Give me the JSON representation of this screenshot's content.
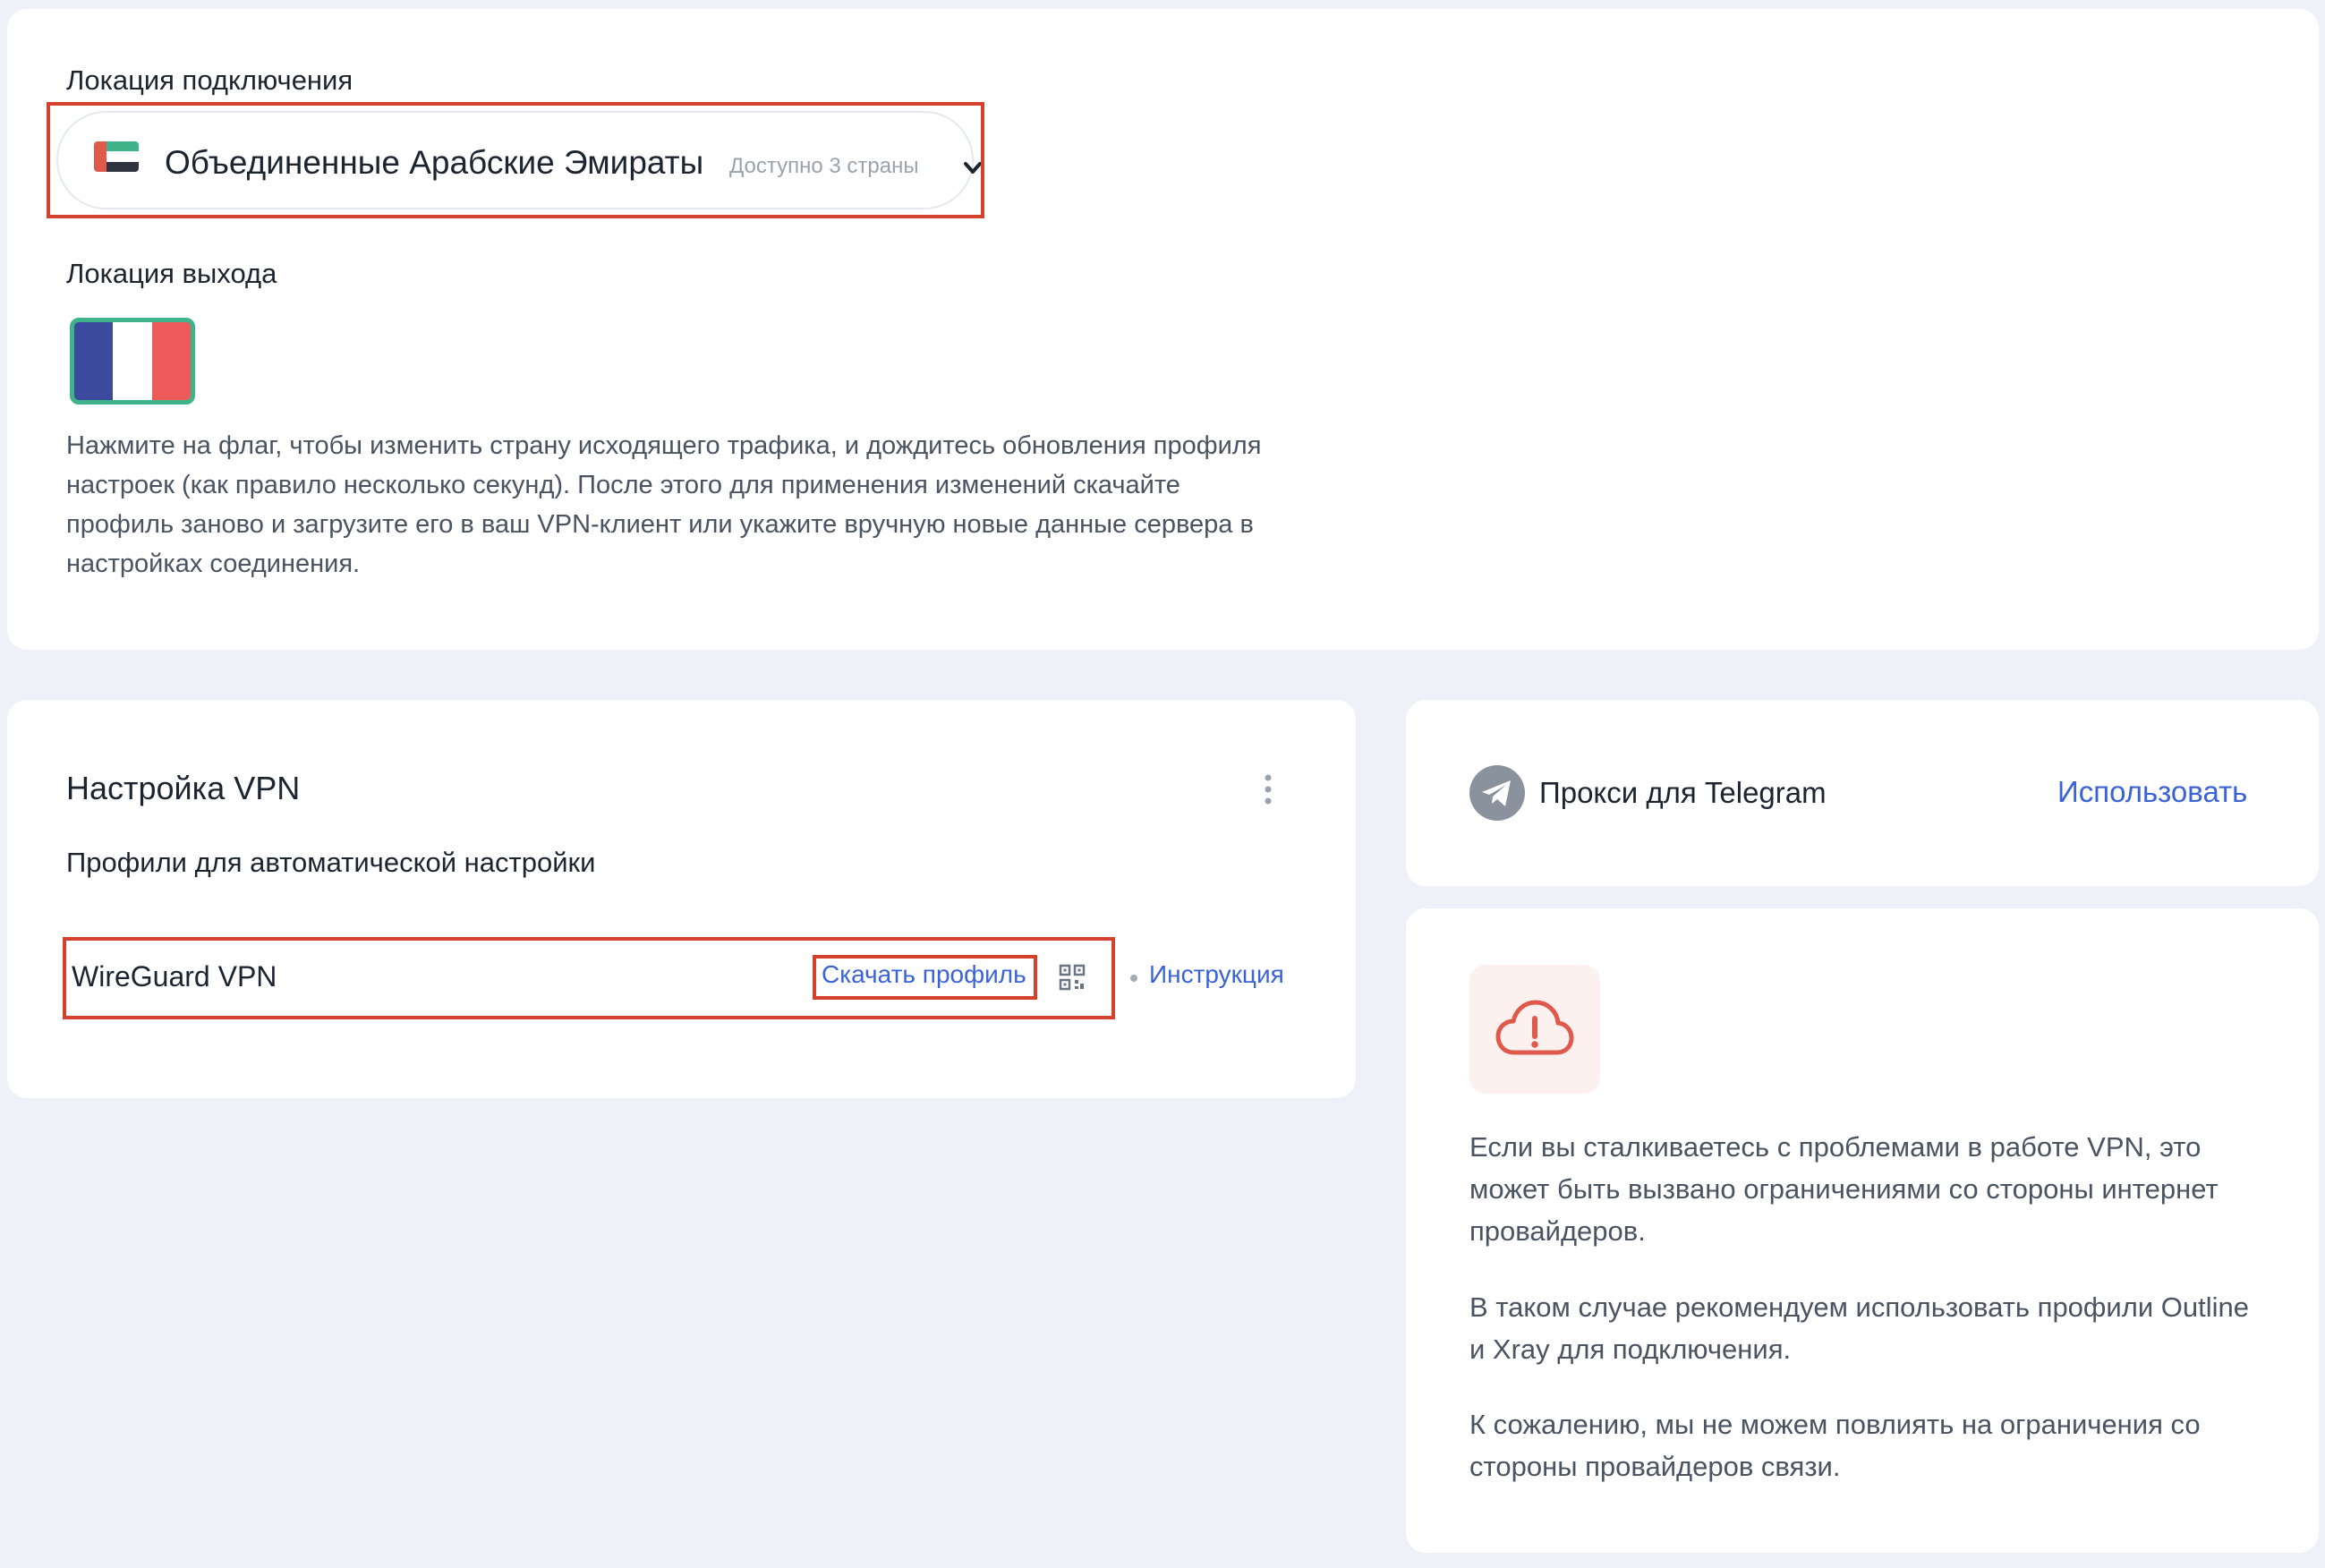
{
  "location": {
    "connection_label": "Локация подключения",
    "selected_country": "Объединенные Арабские Эмираты",
    "available_text": "Доступно 3 страны",
    "exit_label": "Локация выхода",
    "exit_description": "Нажмите на флаг, чтобы изменить страну исходящего трафика, и дождитесь обновления профиля настроек (как правило несколько секунд). После этого для применения изменений скачайте профиль заново и загрузите его в ваш VPN-клиент или укажите вручную новые данные сервера в настройках соединения.",
    "connection_flag_icon": "uae-flag-icon",
    "exit_flag_icon": "france-flag-icon"
  },
  "vpn": {
    "title": "Настройка VPN",
    "profiles_label": "Профили для автоматической настройки",
    "profile": {
      "name": "WireGuard VPN",
      "download_label": "Скачать профиль",
      "instructions_label": "Инструкция"
    }
  },
  "telegram": {
    "title": "Прокси для Telegram",
    "use_label": "Использовать"
  },
  "warning": {
    "paragraphs": [
      "Если вы сталкиваетесь с проблемами в работе VPN, это может быть вызвано ограничениями со стороны интернет провайдеров.",
      "В таком случае рекомендуем использовать профили Outline и Xray для подключения.",
      "К сожалению, мы не можем повлиять на ограничения со стороны провайдеров связи."
    ]
  },
  "colors": {
    "page_bg": "#eef1f8",
    "card_bg": "#ffffff",
    "highlight": "#d4412d",
    "link": "#3a63d8",
    "selected_flag_border": "#3fb38a",
    "alert": "#e05a4c"
  }
}
